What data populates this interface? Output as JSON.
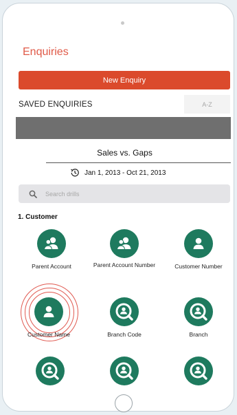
{
  "header": {
    "title": "Enquiries"
  },
  "actions": {
    "new_enquiry": "New Enquiry"
  },
  "saved": {
    "label": "SAVED ENQUIRIES",
    "sort": "A-Z"
  },
  "enquiry": {
    "title": "Sales vs. Gaps",
    "date_range": "Jan 1, 2013 - Oct 21, 2013"
  },
  "search": {
    "placeholder": "Search drills"
  },
  "section": {
    "label": "1. Customer"
  },
  "drills": [
    {
      "label": "Parent Account",
      "icon": "users-icon"
    },
    {
      "label": "Parent Account Number",
      "icon": "users-icon"
    },
    {
      "label": "Customer Number",
      "icon": "user-icon"
    },
    {
      "label": "Customer Name",
      "icon": "user-icon"
    },
    {
      "label": "Branch Code",
      "icon": "user-search-icon"
    },
    {
      "label": "Branch",
      "icon": "user-search-icon"
    },
    {
      "label": "",
      "icon": "user-search-icon"
    },
    {
      "label": "",
      "icon": "user-search-icon"
    },
    {
      "label": "",
      "icon": "user-search-icon"
    }
  ],
  "colors": {
    "accent": "#db4a2c",
    "title": "#e05a48",
    "tile": "#1e7a5e",
    "ripple": "#e0584f"
  }
}
